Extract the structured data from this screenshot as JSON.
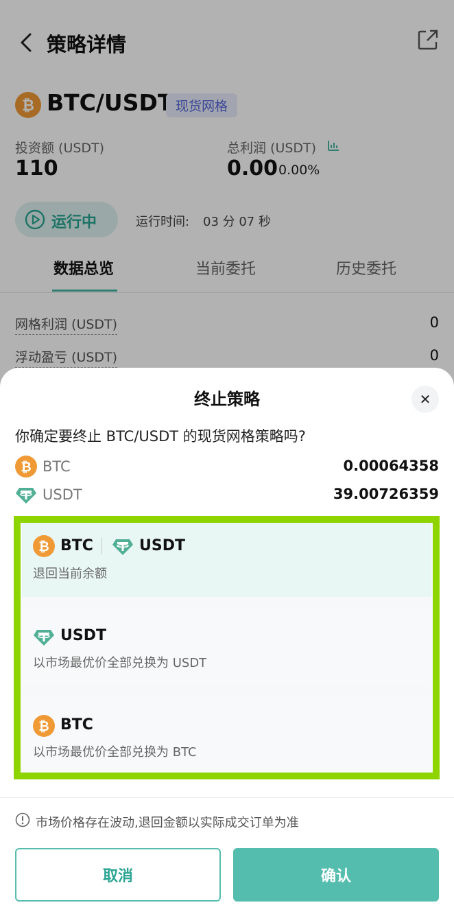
{
  "header": {
    "title": "策略详情"
  },
  "strategy": {
    "pair": "BTC/USDT",
    "tag": "现货网格",
    "invest_label": "投资额 (USDT)",
    "invest_value": "110",
    "profit_label": "总利润 (USDT)",
    "profit_value": "0.00",
    "profit_pct": "0.00%",
    "status": "运行中",
    "runtime_label": "运行时间:",
    "runtime_value": "03 分 07 秒"
  },
  "tabs": [
    {
      "label": "数据总览",
      "active": true
    },
    {
      "label": "当前委托",
      "active": false
    },
    {
      "label": "历史委托",
      "active": false
    }
  ],
  "rows": [
    {
      "label": "网格利润 (USDT)",
      "value": "0"
    },
    {
      "label": "浮动盈亏 (USDT)",
      "value": "0"
    }
  ],
  "sheet": {
    "title": "终止策略",
    "close_icon": "close-icon",
    "question": "你确定要终止 BTC/USDT 的现货网格策略吗?",
    "assets": [
      {
        "name": "BTC",
        "amount": "0.00064358",
        "icon": "btc-icon"
      },
      {
        "name": "USDT",
        "amount": "39.00726359",
        "icon": "usdt-icon"
      }
    ],
    "options": [
      {
        "names": [
          "BTC",
          "USDT"
        ],
        "desc": "退回当前余额",
        "selected": true
      },
      {
        "names": [
          "USDT"
        ],
        "desc": "以市场最优价全部兑换为 USDT",
        "selected": false
      },
      {
        "names": [
          "BTC"
        ],
        "desc": "以市场最优价全部兑换为 BTC",
        "selected": false
      }
    ],
    "notice": "市场价格存在波动,退回金额以实际成交订单为准",
    "cancel_label": "取消",
    "confirm_label": "确认"
  },
  "colors": {
    "accent": "#55bdae",
    "btc": "#f09a36",
    "usdt": "#50af95",
    "highlight_border": "#8ed400"
  }
}
